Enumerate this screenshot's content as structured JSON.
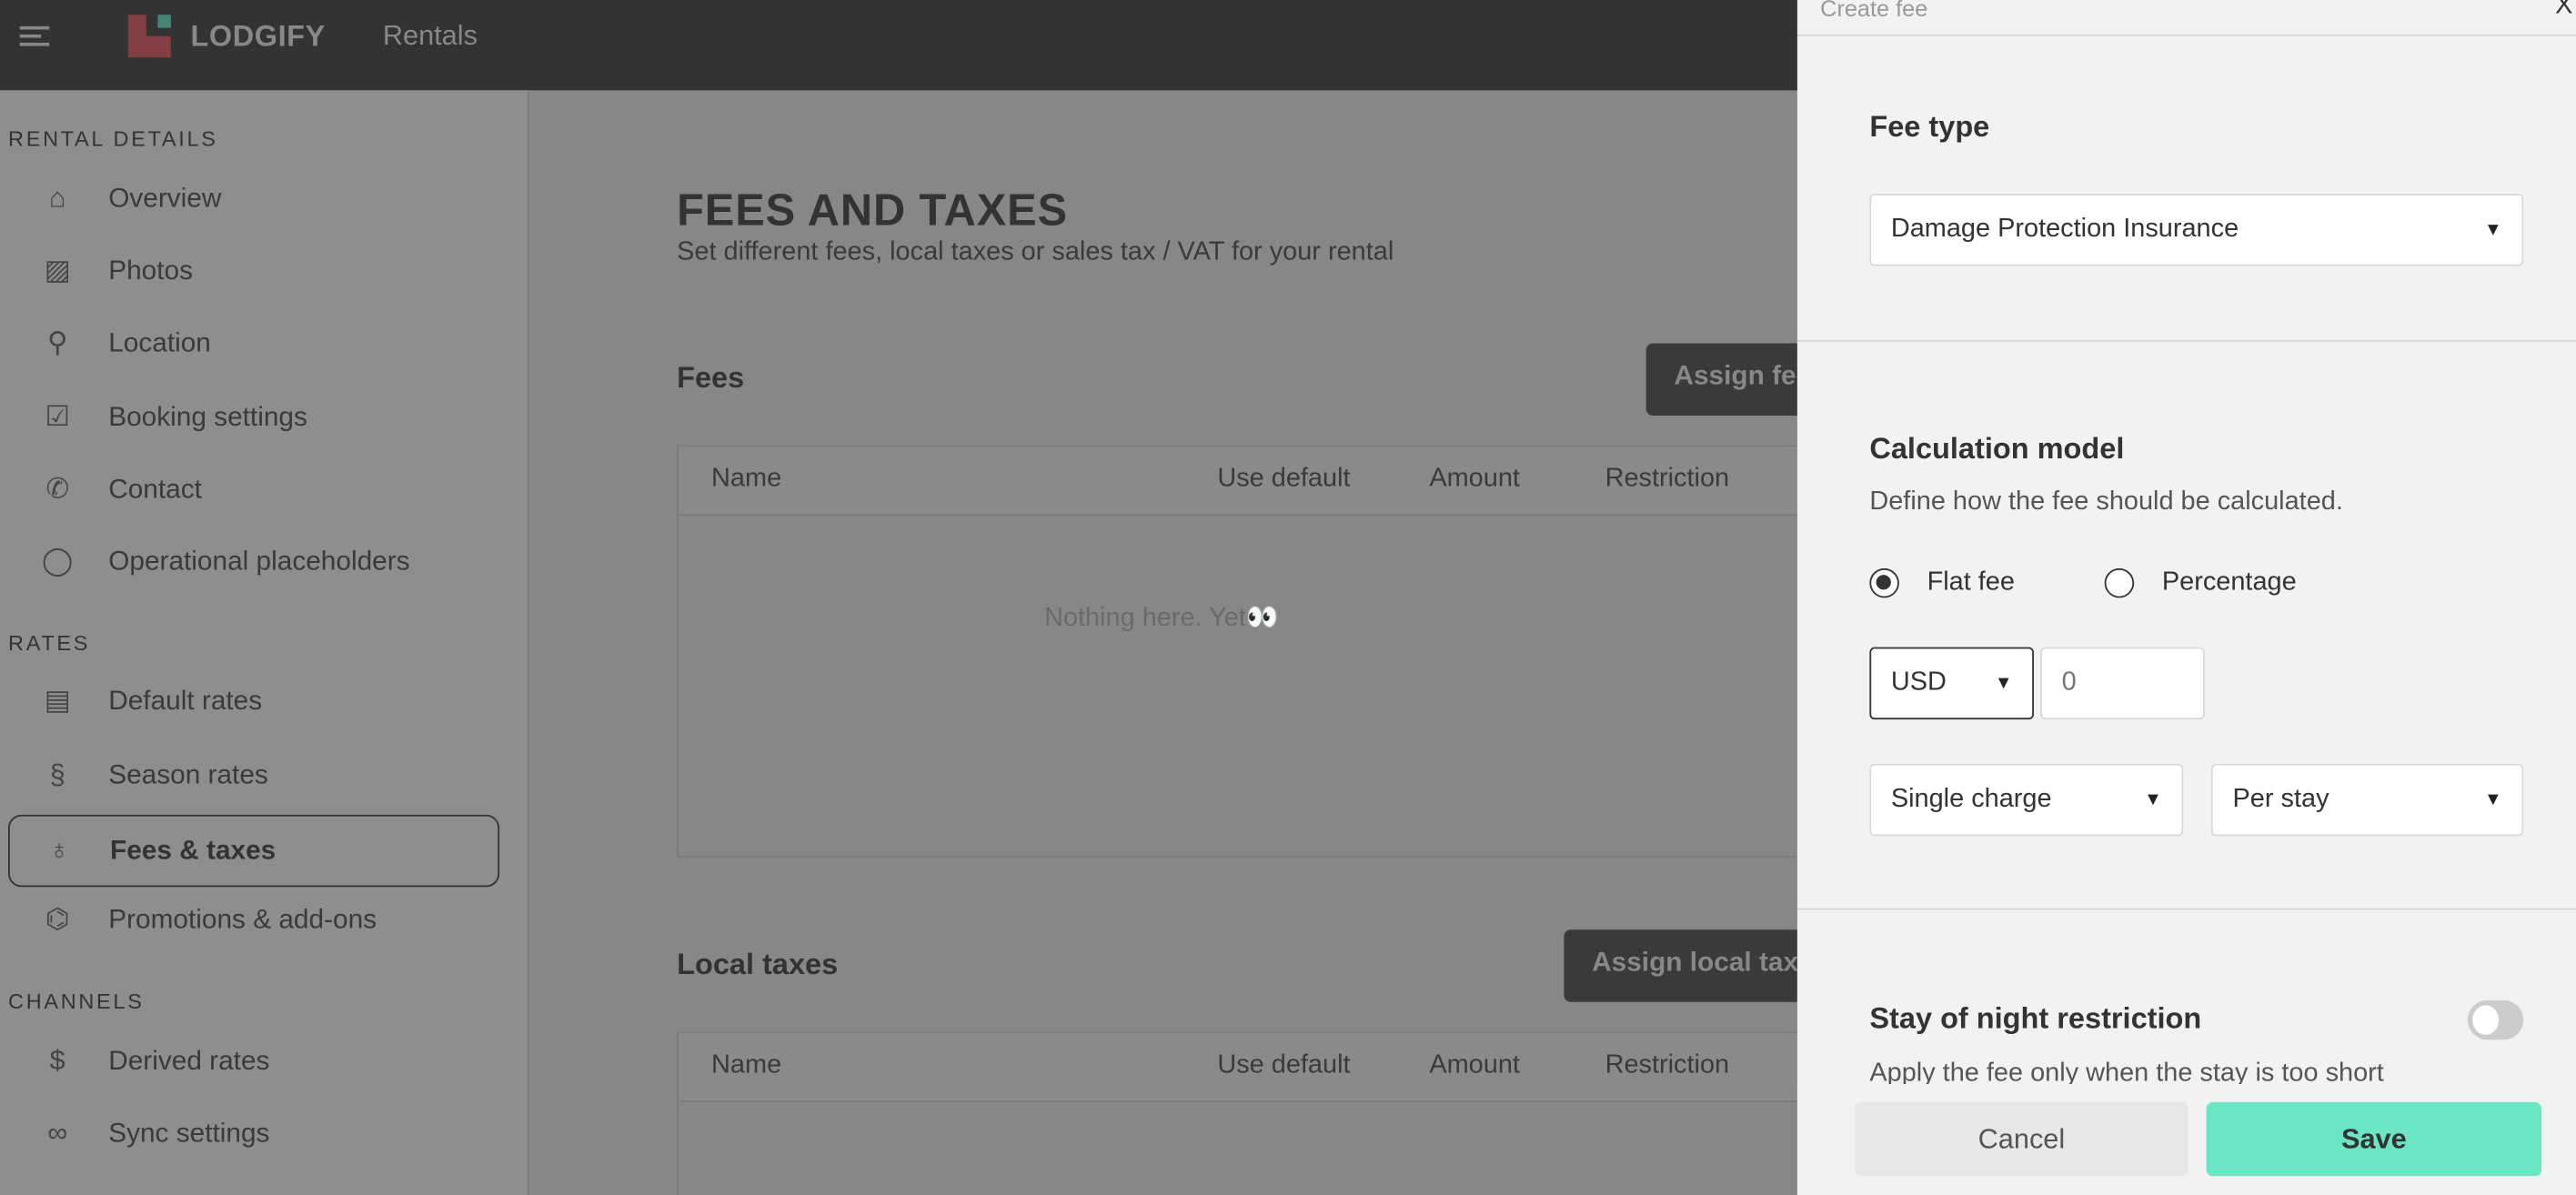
{
  "header": {
    "brand": "LODGIFY",
    "section": "Rentals"
  },
  "sidebar": {
    "sections": [
      {
        "label": "RENTAL DETAILS",
        "items": [
          {
            "label": "Overview",
            "icon": "home-icon"
          },
          {
            "label": "Photos",
            "icon": "image-icon"
          },
          {
            "label": "Location",
            "icon": "pin-icon"
          },
          {
            "label": "Booking settings",
            "icon": "clipboard-icon"
          },
          {
            "label": "Contact",
            "icon": "phone-icon"
          },
          {
            "label": "Operational placeholders",
            "icon": "chat-icon"
          }
        ]
      },
      {
        "label": "RATES",
        "items": [
          {
            "label": "Default rates",
            "icon": "money-icon"
          },
          {
            "label": "Season rates",
            "icon": "season-icon"
          },
          {
            "label": "Fees & taxes",
            "icon": "money-bag-icon",
            "active": true
          },
          {
            "label": "Promotions & add-ons",
            "icon": "tag-icon"
          }
        ]
      },
      {
        "label": "CHANNELS",
        "items": [
          {
            "label": "Derived rates",
            "icon": "document-dollar-icon"
          },
          {
            "label": "Sync settings",
            "icon": "link-icon"
          }
        ]
      }
    ]
  },
  "main": {
    "title": "FEES AND TAXES",
    "subtitle": "Set different fees, local taxes or sales tax / VAT for your rental",
    "fees": {
      "heading": "Fees",
      "button": "Assign fee",
      "columns": [
        "Name",
        "Use default",
        "Amount",
        "Restriction"
      ],
      "empty": "Nothing here. Yet👀"
    },
    "local_taxes": {
      "heading": "Local taxes",
      "button": "Assign local taxes",
      "columns": [
        "Name",
        "Use default",
        "Amount",
        "Restriction"
      ]
    }
  },
  "panel": {
    "title": "Create fee",
    "close": "X",
    "fee_type": {
      "label": "Fee type",
      "value": "Damage Protection Insurance"
    },
    "calc": {
      "label": "Calculation model",
      "description": "Define how the fee should be calculated.",
      "options": [
        "Flat fee",
        "Percentage"
      ],
      "selected": "Flat fee",
      "currency": "USD",
      "amount_placeholder": "0",
      "charge": "Single charge",
      "period": "Per stay"
    },
    "restriction": {
      "label": "Stay of night restriction",
      "description": "Apply the fee only when the stay is too short",
      "enabled": false
    },
    "cancel": "Cancel",
    "save": "Save"
  },
  "colors": {
    "accent": "#6be6c4",
    "header": "#333333",
    "logo_red": "#843f45",
    "logo_green": "#458573"
  }
}
